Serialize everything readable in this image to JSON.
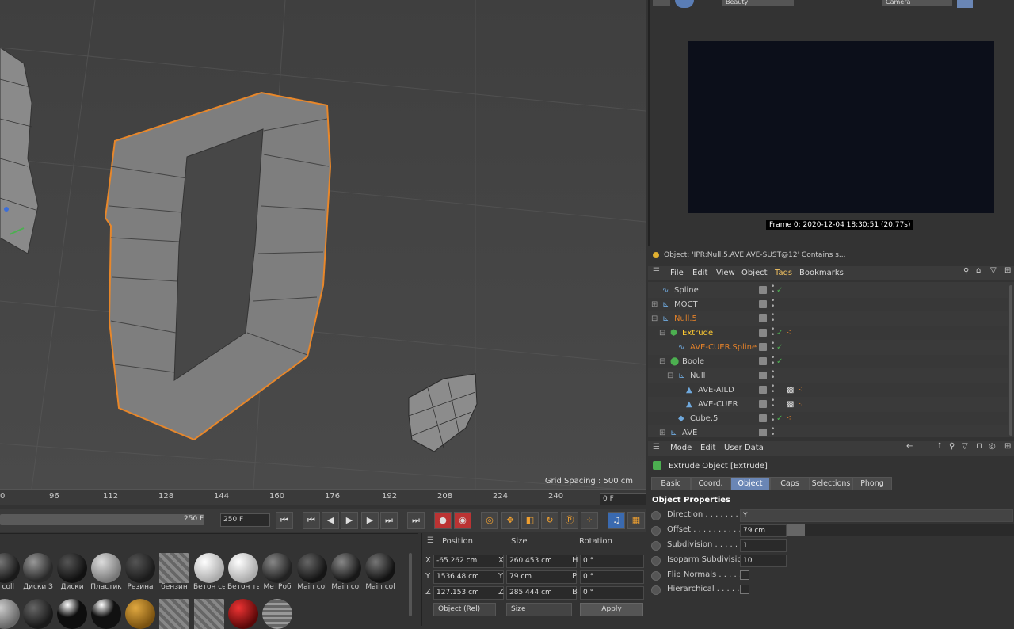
{
  "viewport": {
    "grid_spacing": "Grid Spacing : 500 cm"
  },
  "timeline": {
    "ticks": [
      "0",
      "96",
      "112",
      "128",
      "144",
      "160",
      "176",
      "192",
      "208",
      "224",
      "240"
    ],
    "current_frame": "0 F",
    "range_end": "250 F",
    "range_field": "250 F"
  },
  "materials": {
    "row1": [
      {
        "label": "n coll",
        "color": "#1a1a1a"
      },
      {
        "label": "Диски З",
        "color": "#2a2a2a"
      },
      {
        "label": "Диски",
        "color": "#111111"
      },
      {
        "label": "Пластик",
        "color": "#9a9a9a"
      },
      {
        "label": "Резина",
        "color": "#1c1c1c"
      },
      {
        "label": "бензин",
        "color": "#7a7a7a"
      },
      {
        "label": "Бетон се",
        "color": "#cfcfcf"
      },
      {
        "label": "Бетон те",
        "color": "#cccccc"
      },
      {
        "label": "МетРоб",
        "color": "#222222"
      },
      {
        "label": "Main col",
        "color": "#151515"
      },
      {
        "label": "Main col",
        "color": "#181818"
      },
      {
        "label": "Main col",
        "color": "#131313"
      }
    ],
    "row2_colors": [
      "#888888",
      "#1a1a1a",
      "#0e0e0e",
      "#111111",
      "#a8781a",
      "#7a7a7a",
      "#7a7a7a",
      "#7a7a7a",
      "#8a1010",
      "#777777"
    ]
  },
  "coordinates": {
    "headers": {
      "position": "Position",
      "size": "Size",
      "rotation": "Rotation"
    },
    "rows": [
      {
        "axis": "X",
        "pos": "-65.262 cm",
        "size_axis": "X",
        "size": "260.453 cm",
        "rot_axis": "H",
        "rot": "0 °"
      },
      {
        "axis": "Y",
        "pos": "1536.48 cm",
        "size_axis": "Y",
        "size": "79 cm",
        "rot_axis": "P",
        "rot": "0 °"
      },
      {
        "axis": "Z",
        "pos": "127.153 cm",
        "size_axis": "Z",
        "size": "285.444 cm",
        "rot_axis": "B",
        "rot": "0 °"
      }
    ],
    "mode_dropdown": "Object (Rel)",
    "size_dropdown": "Size",
    "apply_label": "Apply"
  },
  "render": {
    "top_dropdown_1": "Beauty",
    "top_dropdown_2": "Camera",
    "frame_stamp": "Frame  0:  2020-12-04  18:30:51  (20.77s)"
  },
  "object_manager": {
    "status": "Object: 'IPR:Null.5.AVE.AVE-SUST@12' Contains s...",
    "menu": [
      "File",
      "Edit",
      "View",
      "Object",
      "Tags",
      "Bookmarks"
    ],
    "rows": [
      {
        "name": "Spline",
        "color": "#ccc",
        "icon": "spline-icon",
        "check": true
      },
      {
        "name": "MOCT",
        "color": "#ccc",
        "icon": "null-icon",
        "check": false
      },
      {
        "name": "Null.5",
        "color": "#e0802a",
        "icon": "null-icon",
        "check": false
      },
      {
        "name": "Extrude",
        "color": "#ffcc33",
        "icon": "extrude-icon",
        "check": true
      },
      {
        "name": "AVE-CUER.Spline",
        "color": "#e0802a",
        "icon": "spline-icon",
        "check": true
      },
      {
        "name": "Boole",
        "color": "#ccc",
        "icon": "boole-icon",
        "check": true
      },
      {
        "name": "Null",
        "color": "#ccc",
        "icon": "null-icon",
        "check": false
      },
      {
        "name": "AVE-AILD",
        "color": "#ccc",
        "icon": "polygon-icon",
        "check": false
      },
      {
        "name": "AVE-CUER",
        "color": "#ccc",
        "icon": "polygon-icon",
        "check": false
      },
      {
        "name": "Cube.5",
        "color": "#ccc",
        "icon": "cube-icon",
        "check": true
      },
      {
        "name": "AVE",
        "color": "#ccc",
        "icon": "null-icon",
        "check": false
      }
    ]
  },
  "attributes": {
    "menu": [
      "Mode",
      "Edit",
      "User Data"
    ],
    "title": "Extrude Object [Extrude]",
    "tabs": [
      "Basic",
      "Coord.",
      "Object",
      "Caps",
      "Selections",
      "Phong"
    ],
    "active_tab": "Object",
    "section": "Object Properties",
    "props": {
      "direction_label": "Direction . . . . . . . . .",
      "direction_value": "Y",
      "offset_label": "Offset . . . . . . . . . . .",
      "offset_value": "79 cm",
      "subdivision_label": "Subdivision  . . . . . .",
      "subdivision_value": "1",
      "isoparm_label": "Isoparm Subdivision",
      "isoparm_value": "10",
      "flip_label": "Flip Normals . . . . . .",
      "hier_label": "Hierarchical . . . . . . ."
    }
  }
}
